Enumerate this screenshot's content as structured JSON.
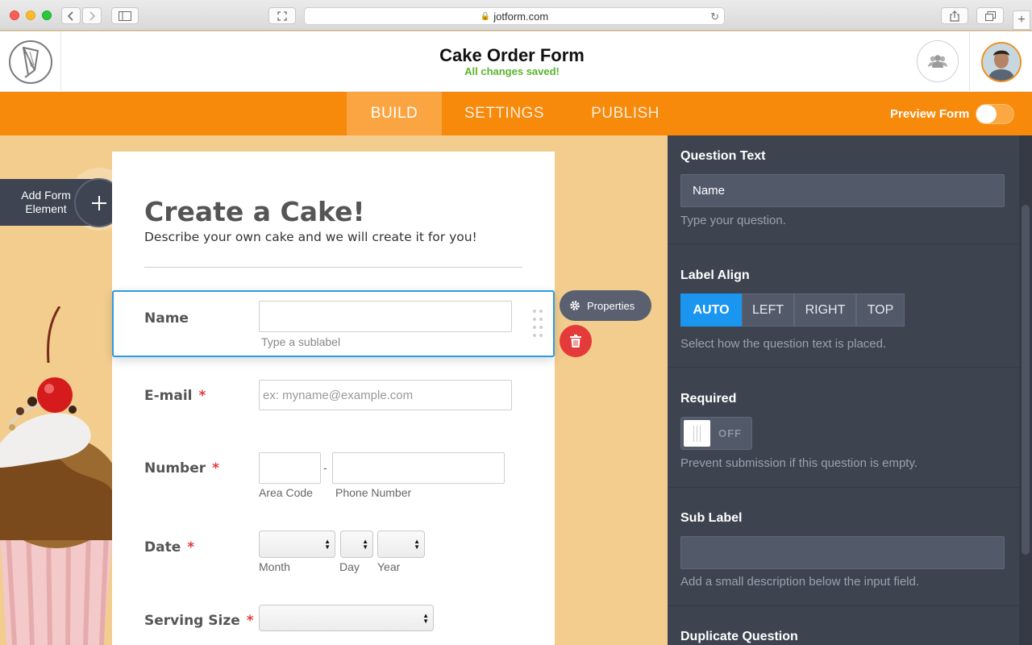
{
  "browser": {
    "url": "jotform.com"
  },
  "header": {
    "form_title": "Cake Order Form",
    "save_status": "All changes saved!"
  },
  "nav": {
    "tabs": [
      {
        "label": "BUILD",
        "active": true
      },
      {
        "label": "SETTINGS",
        "active": false
      },
      {
        "label": "PUBLISH",
        "active": false
      }
    ],
    "preview_label": "Preview Form",
    "preview_enabled": false
  },
  "canvas": {
    "add_element_label": "Add Form Element"
  },
  "form": {
    "heading": "Create a Cake!",
    "subheading": "Describe your own cake and we will create it for you!",
    "fields": {
      "name": {
        "label": "Name",
        "sublabel": "Type a sublabel",
        "value": ""
      },
      "email": {
        "label": "E-mail",
        "required_mark": "*",
        "placeholder": "ex: myname@example.com"
      },
      "number": {
        "label": "Number",
        "required_mark": "*",
        "separator": "-",
        "area_code_label": "Area Code",
        "phone_label": "Phone Number"
      },
      "date": {
        "label": "Date",
        "required_mark": "*",
        "month_label": "Month",
        "day_label": "Day",
        "year_label": "Year"
      },
      "serving_size": {
        "label": "Serving Size",
        "required_mark": "*"
      }
    }
  },
  "field_actions": {
    "properties_label": "Properties"
  },
  "panel": {
    "question_text": {
      "title": "Question Text",
      "value": "Name",
      "help": "Type your question."
    },
    "label_align": {
      "title": "Label Align",
      "options": [
        "AUTO",
        "LEFT",
        "RIGHT",
        "TOP"
      ],
      "selected": "AUTO",
      "help": "Select how the question text is placed."
    },
    "required": {
      "title": "Required",
      "state_label": "OFF",
      "help": "Prevent submission if this question is empty."
    },
    "sub_label": {
      "title": "Sub Label",
      "value": "",
      "help": "Add a small description below the input field."
    },
    "duplicate": {
      "title": "Duplicate Question"
    }
  },
  "colors": {
    "accent_orange": "#f7890b",
    "active_blue": "#1a96f0",
    "panel_bg": "#3e4350",
    "success_green": "#5ab52b",
    "delete_red": "#e43a3a"
  }
}
